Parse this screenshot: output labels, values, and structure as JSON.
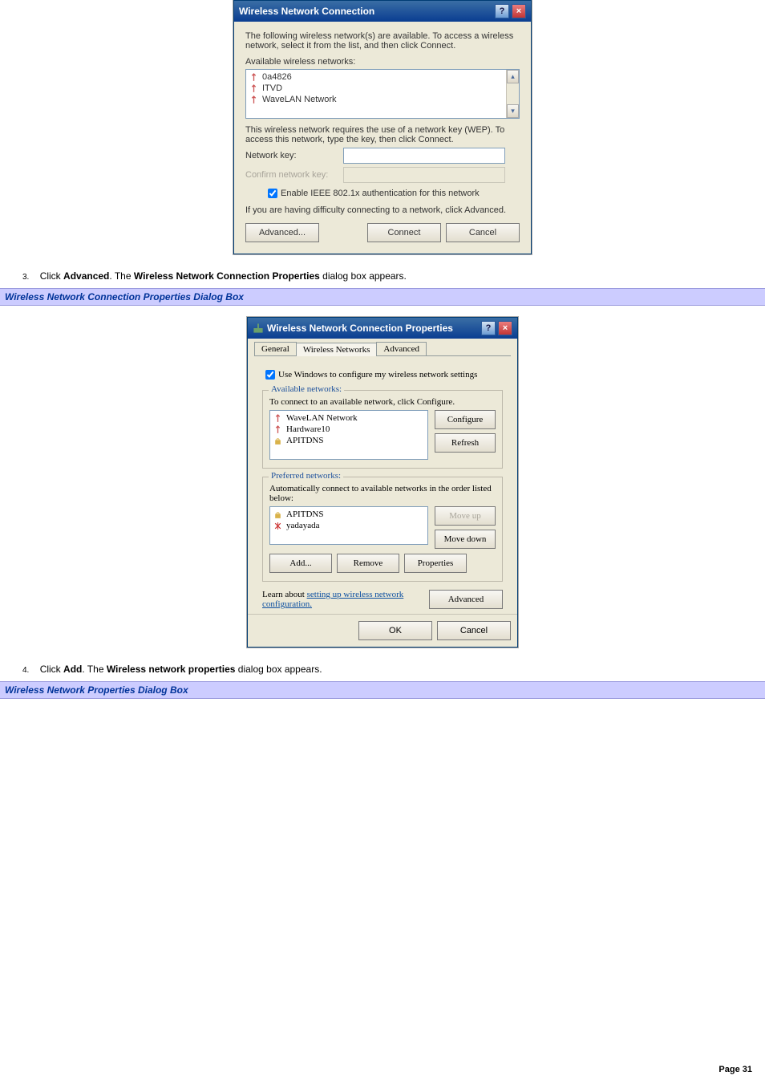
{
  "dialog1": {
    "title": "Wireless Network Connection",
    "intro": "The following wireless network(s) are available. To access a wireless network, select it from the list, and then click Connect.",
    "avail_label": "Available wireless networks:",
    "networks": [
      "0a4826",
      "ITVD",
      "WaveLAN Network"
    ],
    "wep_note": "This wireless network requires the use of a network key (WEP). To access this network, type the key, then click Connect.",
    "key_label": "Network key:",
    "confirm_label": "Confirm network key:",
    "enable_label": "Enable IEEE 802.1x authentication for this network",
    "difficulty": "If you are having difficulty connecting to a network, click Advanced.",
    "btn_advanced": "Advanced...",
    "btn_connect": "Connect",
    "btn_cancel": "Cancel"
  },
  "step3": {
    "num": "3.",
    "pre": "Click ",
    "b1": "Advanced",
    "mid": ". The ",
    "b2": "Wireless Network Connection Properties",
    "post": " dialog box appears."
  },
  "bar1": "Wireless Network Connection Properties Dialog Box",
  "dialog2": {
    "title": "Wireless Network Connection Properties",
    "tabs": [
      "General",
      "Wireless Networks",
      "Advanced"
    ],
    "use_windows": "Use Windows to configure my wireless network settings",
    "avail_legend": "Available networks:",
    "avail_hint": "To connect to an available network, click Configure.",
    "avail_list": [
      "WaveLAN Network",
      "Hardware10",
      "APITDNS"
    ],
    "btn_configure": "Configure",
    "btn_refresh": "Refresh",
    "pref_legend": "Preferred networks:",
    "pref_hint": "Automatically connect to available networks in the order listed below:",
    "pref_list": [
      "APITDNS",
      "yadayada"
    ],
    "btn_moveup": "Move up",
    "btn_movedown": "Move down",
    "btn_add": "Add...",
    "btn_remove": "Remove",
    "btn_properties": "Properties",
    "learn_pre": "Learn about ",
    "learn_link": "setting up wireless network configuration.",
    "btn_advanced": "Advanced",
    "btn_ok": "OK",
    "btn_cancel": "Cancel"
  },
  "step4": {
    "num": "4.",
    "pre": "Click ",
    "b1": "Add",
    "mid": ". The ",
    "b2": "Wireless network properties",
    "post": " dialog box appears."
  },
  "bar2": "Wireless Network Properties Dialog Box",
  "footer": {
    "label": "Page ",
    "num": "31"
  }
}
